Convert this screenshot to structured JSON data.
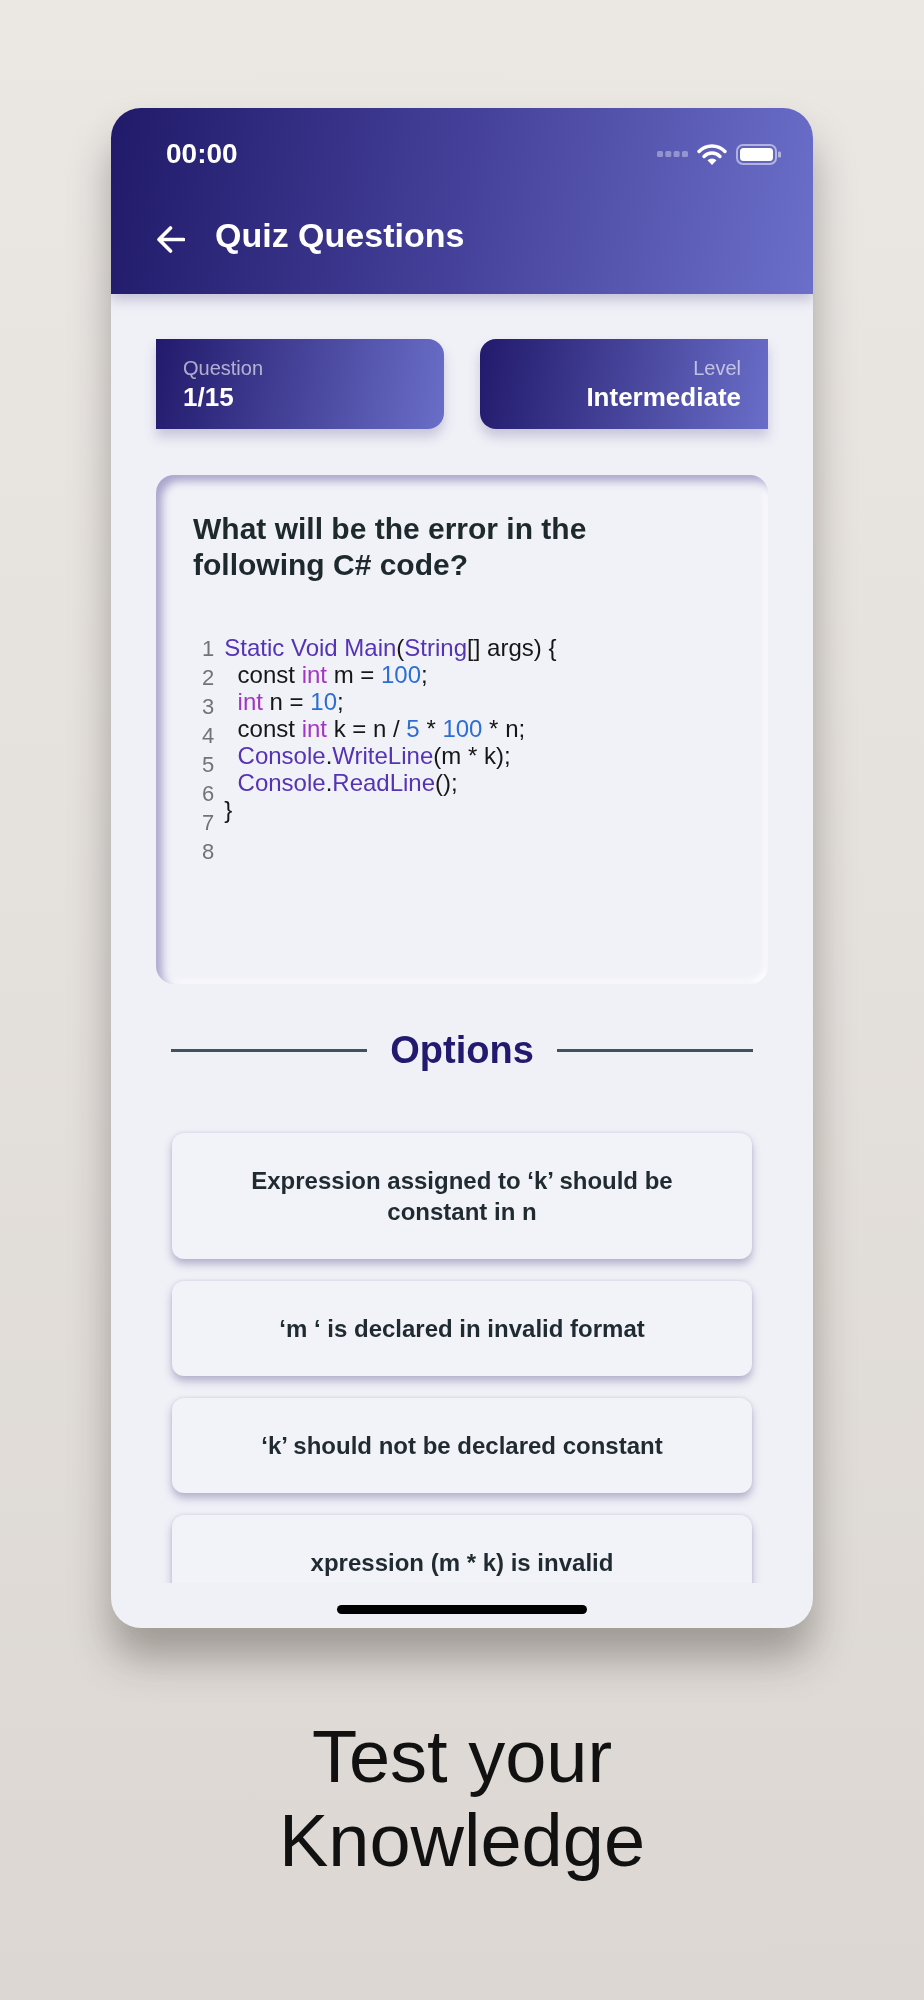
{
  "status_bar": {
    "time": "00:00"
  },
  "app_bar": {
    "title": "Quiz Questions"
  },
  "stats": [
    {
      "label": "Question",
      "value": "1/15"
    },
    {
      "label": "Level",
      "value": "Intermediate"
    }
  ],
  "question": {
    "text": "What will be the error in the following C# code?",
    "code": [
      {
        "number": "1",
        "tokens": [
          {
            "text": "Static Void Main",
            "kind": "type"
          },
          {
            "text": "(",
            "kind": "plain"
          },
          {
            "text": "String",
            "kind": "type"
          },
          {
            "text": "[] args) {",
            "kind": "plain"
          }
        ]
      },
      {
        "number": "2",
        "tokens": [
          {
            "text": "  const ",
            "kind": "plain"
          },
          {
            "text": "int",
            "kind": "keyword"
          },
          {
            "text": " m = ",
            "kind": "plain"
          },
          {
            "text": "100",
            "kind": "number"
          },
          {
            "text": ";",
            "kind": "plain"
          }
        ]
      },
      {
        "number": "3",
        "tokens": [
          {
            "text": "  int",
            "kind": "keyword"
          },
          {
            "text": " n = ",
            "kind": "plain"
          },
          {
            "text": "10",
            "kind": "number"
          },
          {
            "text": ";",
            "kind": "plain"
          }
        ]
      },
      {
        "number": "4",
        "tokens": [
          {
            "text": "  const ",
            "kind": "plain"
          },
          {
            "text": "int",
            "kind": "keyword"
          },
          {
            "text": " k = n / ",
            "kind": "plain"
          },
          {
            "text": "5",
            "kind": "number"
          },
          {
            "text": " * ",
            "kind": "plain"
          },
          {
            "text": "100",
            "kind": "number"
          },
          {
            "text": " * n;",
            "kind": "plain"
          }
        ]
      },
      {
        "number": "5",
        "tokens": [
          {
            "text": "  Console",
            "kind": "type"
          },
          {
            "text": ".",
            "kind": "plain"
          },
          {
            "text": "WriteLine",
            "kind": "type"
          },
          {
            "text": "(m * k);",
            "kind": "plain"
          }
        ]
      },
      {
        "number": "6",
        "tokens": [
          {
            "text": "  Console",
            "kind": "type"
          },
          {
            "text": ".",
            "kind": "plain"
          },
          {
            "text": "ReadLine",
            "kind": "type"
          },
          {
            "text": "();",
            "kind": "plain"
          }
        ]
      },
      {
        "number": "7",
        "tokens": [
          {
            "text": "}",
            "kind": "plain"
          }
        ]
      },
      {
        "number": "8"
      }
    ]
  },
  "options_heading": "Options",
  "options": [
    {
      "text": "Expression assigned to ‘k’ should be constant in n",
      "selected": false
    },
    {
      "text": "‘m ‘ is declared in invalid format",
      "selected": false
    },
    {
      "text": "‘k’ should not be declared constant",
      "selected": false
    },
    {
      "text": "xpression (m * k) is invalid",
      "selected": false
    }
  ],
  "caption": "Test your Knowledge"
}
